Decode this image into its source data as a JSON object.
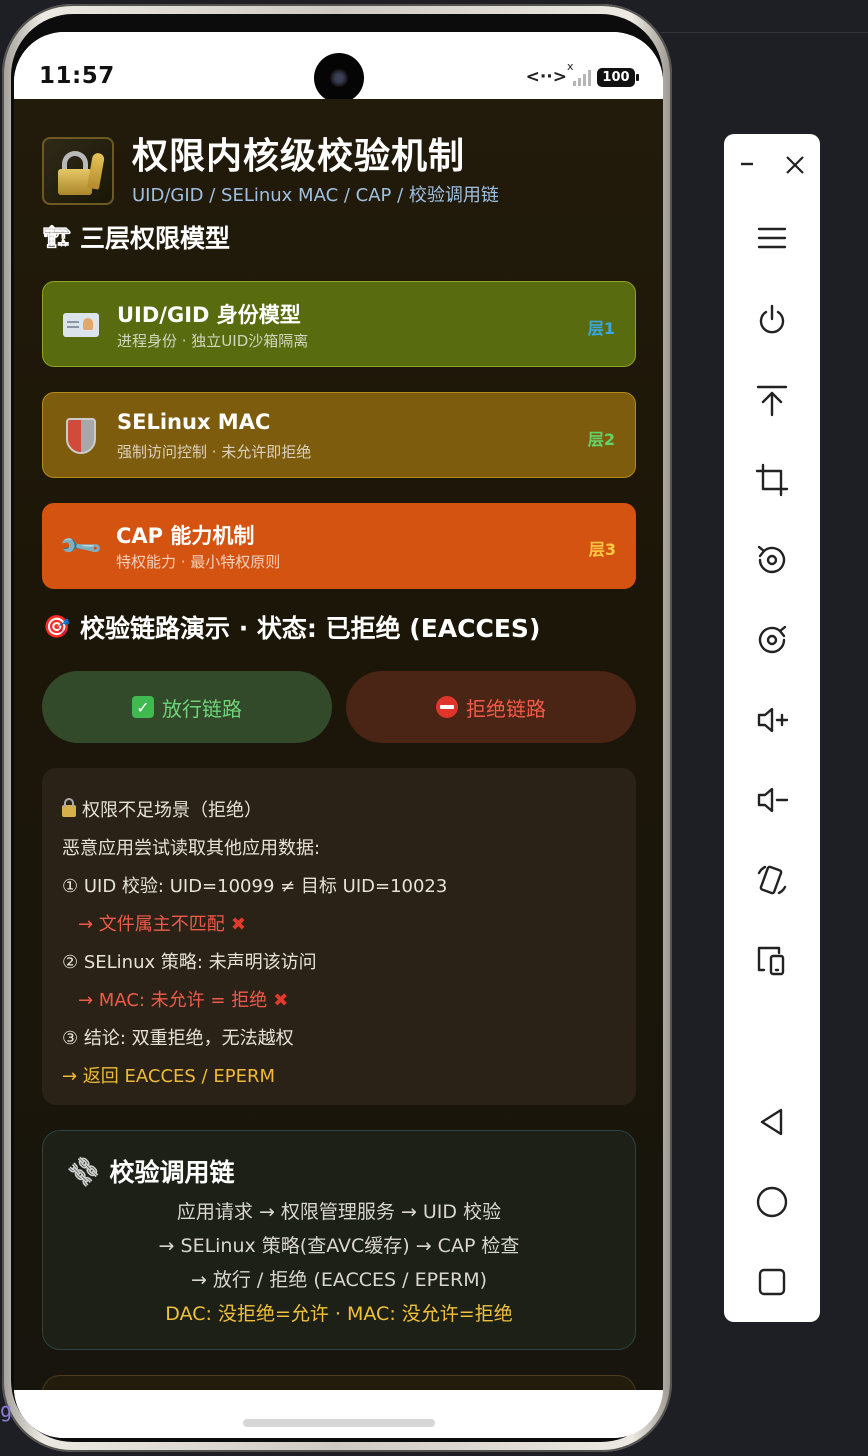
{
  "status": {
    "time": "11:57",
    "battery": "100",
    "network": "<··>",
    "signal_x": "x"
  },
  "header": {
    "title": "权限内核级校验机制",
    "subtitle": "UID/GID / SELinux MAC / CAP / 校验调用链"
  },
  "model_section": {
    "title": "三层权限模型"
  },
  "layers": [
    {
      "name": "UID/GID 身份模型",
      "desc": "进程身份 · 独立UID沙箱隔离",
      "badge": "层1",
      "badge_color": "#3aa8e0",
      "icon": "id-card-icon"
    },
    {
      "name": "SELinux MAC",
      "desc": "强制访问控制 · 未允许即拒绝",
      "badge": "层2",
      "badge_color": "#63d46a",
      "icon": "shield-icon"
    },
    {
      "name": "CAP 能力机制",
      "desc": "特权能力 · 最小特权原则",
      "badge": "层3",
      "badge_color": "#ffc845",
      "icon": "wrench-icon"
    }
  ],
  "demo_section": {
    "title": "校验链路演示 · 状态: 已拒绝 (EACCES)"
  },
  "buttons": {
    "allow": "放行链路",
    "deny": "拒绝链路"
  },
  "scenario": {
    "title": "权限不足场景（拒绝）",
    "lines": [
      {
        "text": "恶意应用尝试读取其他应用数据:",
        "style": "normal"
      },
      {
        "text": "① UID 校验: UID=10099 ≠ 目标 UID=10023",
        "style": "normal"
      },
      {
        "text": "→ 文件属主不匹配",
        "style": "red",
        "mark": "✖"
      },
      {
        "text": "② SELinux 策略: 未声明该访问",
        "style": "normal"
      },
      {
        "text": "→ MAC: 未允许 = 拒绝",
        "style": "red",
        "mark": "✖"
      },
      {
        "text": "③ 结论: 双重拒绝，无法越权",
        "style": "normal"
      },
      {
        "text": "→ 返回 EACCES / EPERM",
        "style": "gold"
      }
    ]
  },
  "chain": {
    "title": "校验调用链",
    "lines": [
      "应用请求 → 权限管理服务 → UID 校验",
      "→ SELinux 策略(查AVC缓存) → CAP 检查",
      "→ 放行 / 拒绝 (EACCES / EPERM)"
    ],
    "footer": "DAC: 没拒绝=允许 · MAC: 没允许=拒绝"
  },
  "colors": {
    "accent_gold": "#f2c13c",
    "deny_red": "#f25a4a",
    "allow_green": "#6fd37a"
  },
  "side_panel": {
    "items": [
      "menu-icon",
      "power-icon",
      "upload-icon",
      "crop-icon",
      "rotate-left-icon",
      "rotate-right-icon",
      "volume-up-icon",
      "volume-down-icon",
      "device-rotate-icon",
      "devices-icon",
      "back-icon",
      "home-icon",
      "overview-icon"
    ]
  }
}
